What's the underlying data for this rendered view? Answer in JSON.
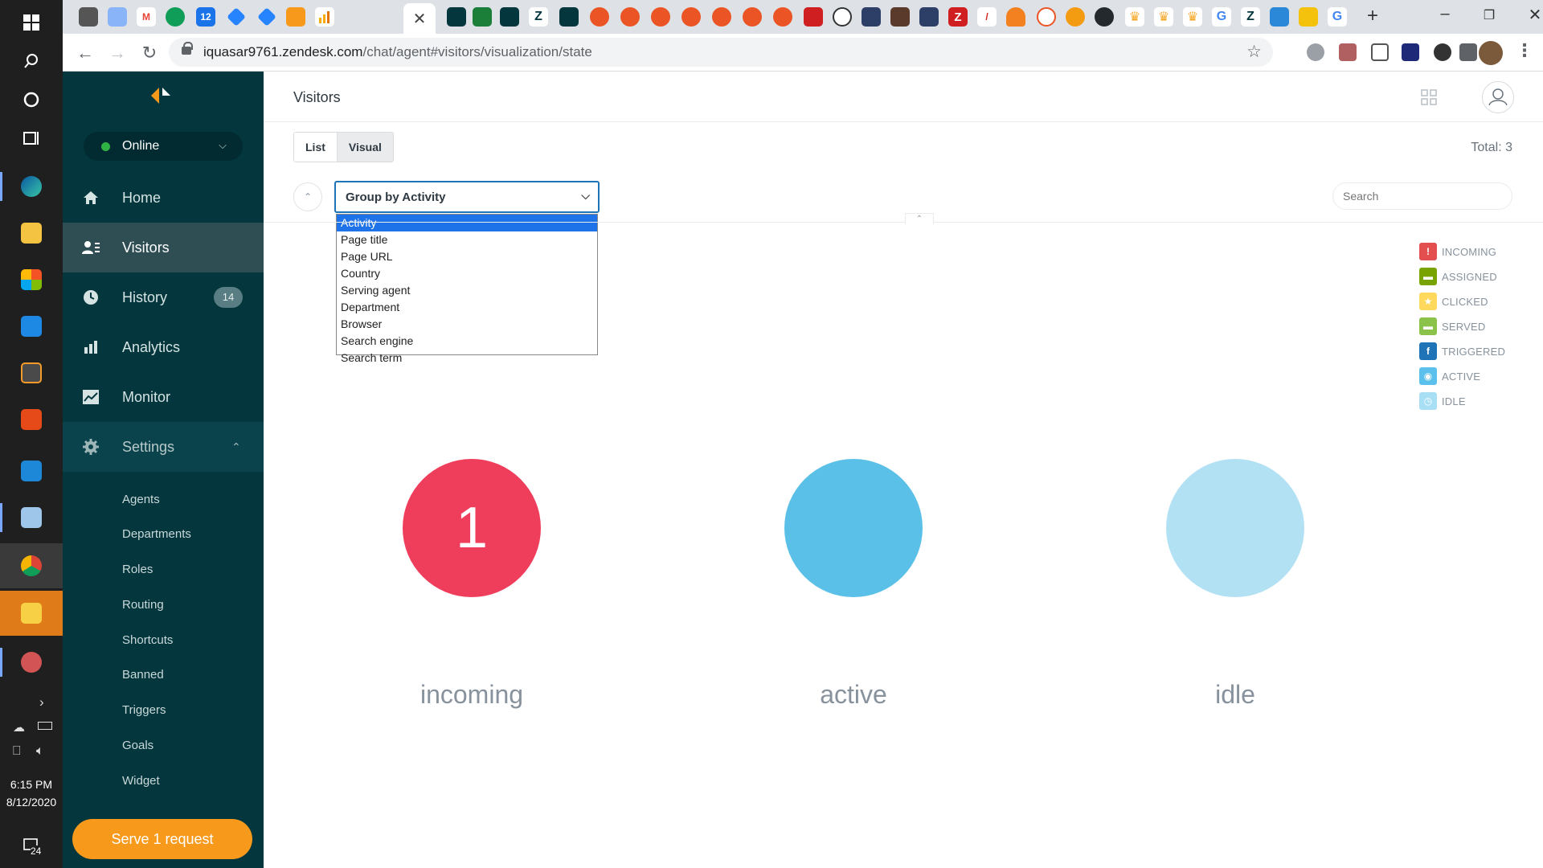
{
  "os": {
    "clock_time": "6:15 PM",
    "clock_date": "8/12/2020",
    "notification_count": "24"
  },
  "browser": {
    "url_host": "iquasar9761.zendesk.com",
    "url_path": "/chat/agent#visitors/visualization/state",
    "active_tab_icon": "close-icon"
  },
  "sidebar": {
    "status": "Online",
    "nav": {
      "home": "Home",
      "visitors": "Visitors",
      "history": "History",
      "history_badge": "14",
      "analytics": "Analytics",
      "monitor": "Monitor",
      "settings": "Settings"
    },
    "settings_items": [
      "Agents",
      "Departments",
      "Roles",
      "Routing",
      "Shortcuts",
      "Banned",
      "Triggers",
      "Goals",
      "Widget"
    ],
    "serve_button": "Serve 1 request"
  },
  "main": {
    "title": "Visitors",
    "view_tabs": [
      "List",
      "Visual"
    ],
    "total": "Total: 3",
    "group_select": "Group by Activity",
    "group_options": [
      "Activity",
      "Page title",
      "Page URL",
      "Country",
      "Serving agent",
      "Department",
      "Browser",
      "Search engine",
      "Search term"
    ],
    "selected_option": "Activity",
    "search_placeholder": "Search",
    "legend": [
      {
        "label": "INCOMING",
        "color": "#e34f4f",
        "icon": "exclamation-icon"
      },
      {
        "label": "ASSIGNED",
        "color": "#78a300",
        "icon": "chat-icon"
      },
      {
        "label": "CLICKED",
        "color": "#ffd95e",
        "icon": "star-icon"
      },
      {
        "label": "SERVED",
        "color": "#8bc34a",
        "icon": "chat-icon"
      },
      {
        "label": "TRIGGERED",
        "color": "#1f73b7",
        "icon": "trigger-icon"
      },
      {
        "label": "ACTIVE",
        "color": "#5bc0eb",
        "icon": "eye-icon"
      },
      {
        "label": "IDLE",
        "color": "#a9dff4",
        "icon": "clock-icon"
      }
    ],
    "bubbles": [
      {
        "label": "incoming",
        "count": "1",
        "color": "#ef3e5c"
      },
      {
        "label": "active",
        "count": "",
        "color": "#5bc0e8"
      },
      {
        "label": "idle",
        "count": "",
        "color": "#b3e1f4"
      }
    ]
  }
}
